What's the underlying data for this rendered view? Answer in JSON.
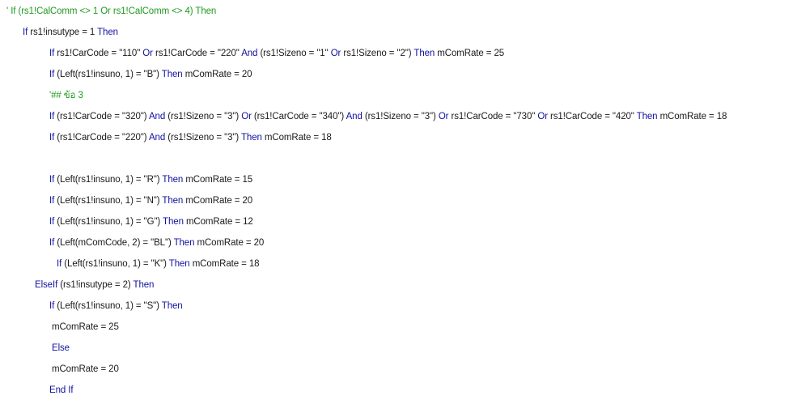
{
  "colors": {
    "keyword": "#1010a0",
    "text": "#1a1a1a",
    "comment": "#1f9a1f",
    "background": "#ffffff"
  },
  "lines": [
    {
      "segments": [
        {
          "t": "' If (rs1!CalComm <> 1 Or rs1!CalComm <> 4) Then",
          "k": "cm"
        }
      ]
    },
    {
      "segments": [
        {
          "t": "If",
          "k": "kw"
        },
        {
          "t": " rs1!insutype = 1 ",
          "k": "tx"
        },
        {
          "t": "Then",
          "k": "kw"
        }
      ]
    },
    {
      "segments": [
        {
          "t": "If",
          "k": "kw"
        },
        {
          "t": " rs1!CarCode = \"110\" ",
          "k": "tx"
        },
        {
          "t": "Or",
          "k": "kw"
        },
        {
          "t": " rs1!CarCode = \"220\" ",
          "k": "tx"
        },
        {
          "t": "And",
          "k": "kw"
        },
        {
          "t": " (rs1!Sizeno = \"1\" ",
          "k": "tx"
        },
        {
          "t": "Or",
          "k": "kw"
        },
        {
          "t": " rs1!Sizeno = \"2\") ",
          "k": "tx"
        },
        {
          "t": "Then",
          "k": "kw"
        },
        {
          "t": " mComRate = 25",
          "k": "tx"
        }
      ]
    },
    {
      "segments": [
        {
          "t": "If",
          "k": "kw"
        },
        {
          "t": " (Left(rs1!insuno, 1) = \"B\") ",
          "k": "tx"
        },
        {
          "t": "Then",
          "k": "kw"
        },
        {
          "t": " mComRate = 20",
          "k": "tx"
        }
      ]
    },
    {
      "segments": [
        {
          "t": "'## ข้อ 3",
          "k": "cm"
        }
      ]
    },
    {
      "segments": [
        {
          "t": "If",
          "k": "kw"
        },
        {
          "t": " (rs1!CarCode = \"320\") ",
          "k": "tx"
        },
        {
          "t": "And",
          "k": "kw"
        },
        {
          "t": " (rs1!Sizeno = \"3\") ",
          "k": "tx"
        },
        {
          "t": "Or",
          "k": "kw"
        },
        {
          "t": " (rs1!CarCode = \"340\") ",
          "k": "tx"
        },
        {
          "t": "And",
          "k": "kw"
        },
        {
          "t": " (rs1!Sizeno = \"3\") ",
          "k": "tx"
        },
        {
          "t": "Or",
          "k": "kw"
        },
        {
          "t": " rs1!CarCode = \"730\" ",
          "k": "tx"
        },
        {
          "t": "Or",
          "k": "kw"
        },
        {
          "t": " rs1!CarCode = \"420\" ",
          "k": "tx"
        },
        {
          "t": "Then",
          "k": "kw"
        },
        {
          "t": " mComRate = 18",
          "k": "tx"
        }
      ]
    },
    {
      "segments": [
        {
          "t": "If",
          "k": "kw"
        },
        {
          "t": " (rs1!CarCode = \"220\") ",
          "k": "tx"
        },
        {
          "t": "And",
          "k": "kw"
        },
        {
          "t": " (rs1!Sizeno = \"3\") ",
          "k": "tx"
        },
        {
          "t": "Then",
          "k": "kw"
        },
        {
          "t": " mComRate = 18",
          "k": "tx"
        }
      ]
    },
    {
      "segments": []
    },
    {
      "segments": [
        {
          "t": "If",
          "k": "kw"
        },
        {
          "t": " (Left(rs1!insuno, 1) = \"R\") ",
          "k": "tx"
        },
        {
          "t": "Then",
          "k": "kw"
        },
        {
          "t": " mComRate = 15",
          "k": "tx"
        }
      ]
    },
    {
      "segments": [
        {
          "t": "If",
          "k": "kw"
        },
        {
          "t": " (Left(rs1!insuno, 1) = \"N\") ",
          "k": "tx"
        },
        {
          "t": "Then",
          "k": "kw"
        },
        {
          "t": " mComRate = 20",
          "k": "tx"
        }
      ]
    },
    {
      "segments": [
        {
          "t": "If",
          "k": "kw"
        },
        {
          "t": " (Left(rs1!insuno, 1) = \"G\") ",
          "k": "tx"
        },
        {
          "t": "Then",
          "k": "kw"
        },
        {
          "t": " mComRate = 12",
          "k": "tx"
        }
      ]
    },
    {
      "segments": [
        {
          "t": "If",
          "k": "kw"
        },
        {
          "t": " (Left(mComCode, 2) = \"BL\") ",
          "k": "tx"
        },
        {
          "t": "Then",
          "k": "kw"
        },
        {
          "t": " mComRate = 20",
          "k": "tx"
        }
      ]
    },
    {
      "segments": [
        {
          "t": "If",
          "k": "kw"
        },
        {
          "t": " (Left(rs1!insuno, 1) = \"K\") ",
          "k": "tx"
        },
        {
          "t": "Then",
          "k": "kw"
        },
        {
          "t": " mComRate = 18",
          "k": "tx"
        }
      ]
    },
    {
      "segments": [
        {
          "t": "ElseIf",
          "k": "kw"
        },
        {
          "t": " (rs1!insutype = 2) ",
          "k": "tx"
        },
        {
          "t": "Then",
          "k": "kw"
        }
      ]
    },
    {
      "segments": [
        {
          "t": "If",
          "k": "kw"
        },
        {
          "t": " (Left(rs1!insuno, 1) = \"S\") ",
          "k": "tx"
        },
        {
          "t": "Then",
          "k": "kw"
        }
      ]
    },
    {
      "segments": [
        {
          "t": "mComRate = 25",
          "k": "tx"
        }
      ]
    },
    {
      "segments": [
        {
          "t": "Else",
          "k": "kw"
        }
      ]
    },
    {
      "segments": [
        {
          "t": "mComRate = 20",
          "k": "tx"
        }
      ]
    },
    {
      "segments": [
        {
          "t": "End If",
          "k": "kw"
        }
      ]
    }
  ]
}
